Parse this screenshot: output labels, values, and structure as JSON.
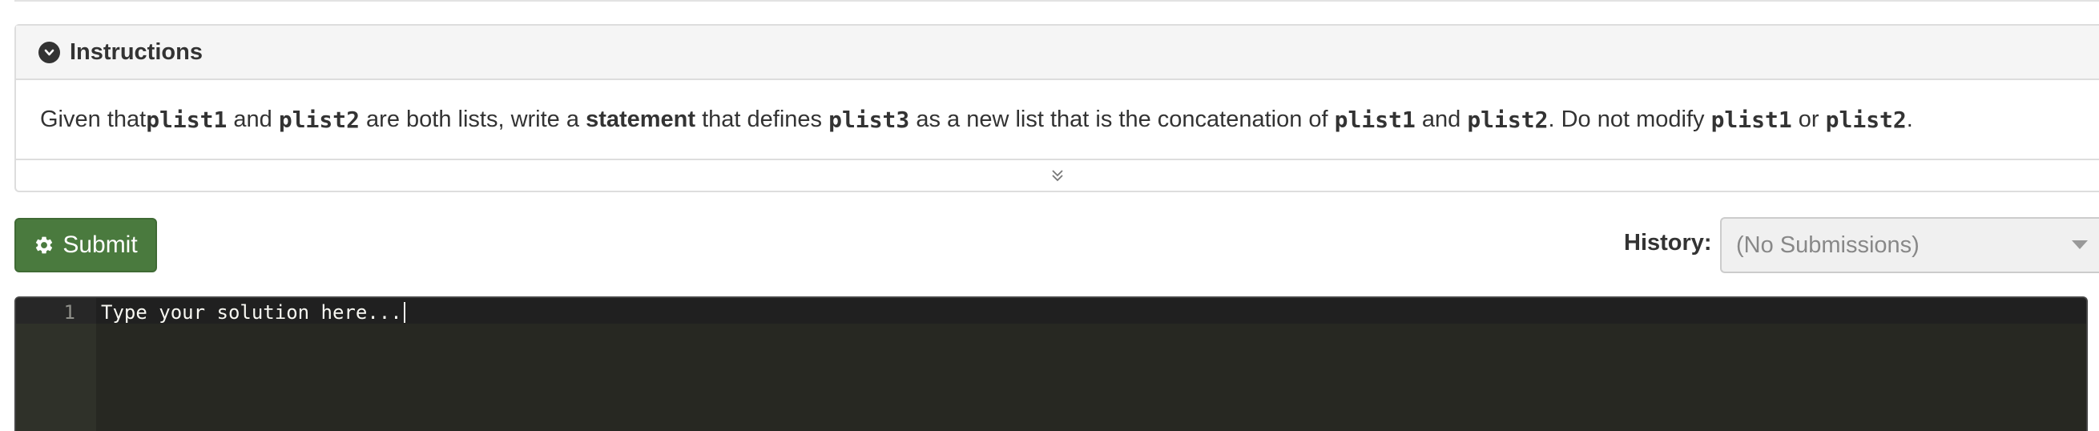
{
  "instructions": {
    "title": "Instructions",
    "toggle_icon": "chevron-down-circle-icon",
    "expand_icon": "double-chevron-down-icon",
    "text": {
      "t1": "Given that ",
      "c1": "plist1",
      "t2": " and ",
      "c2": "plist2",
      "t3": " are both lists, write a ",
      "b1": "statement",
      "t4": " that defines ",
      "c3": "plist3",
      "t5": " as a new list that is the concatenation of ",
      "c4": "plist1",
      "t6": " and ",
      "c5": "plist2",
      "t7": ". Do not modify ",
      "c6": "plist1",
      "t8": " or ",
      "c7": "plist2",
      "t9": "."
    }
  },
  "toolbar": {
    "submit_label": "Submit",
    "submit_icon": "gear-icon",
    "submit_color": "#4a7a3e",
    "history_label": "History:",
    "history_value": "(No Submissions)"
  },
  "editor": {
    "line_number": "1",
    "placeholder": "Type your solution here...",
    "background": "#272822"
  }
}
